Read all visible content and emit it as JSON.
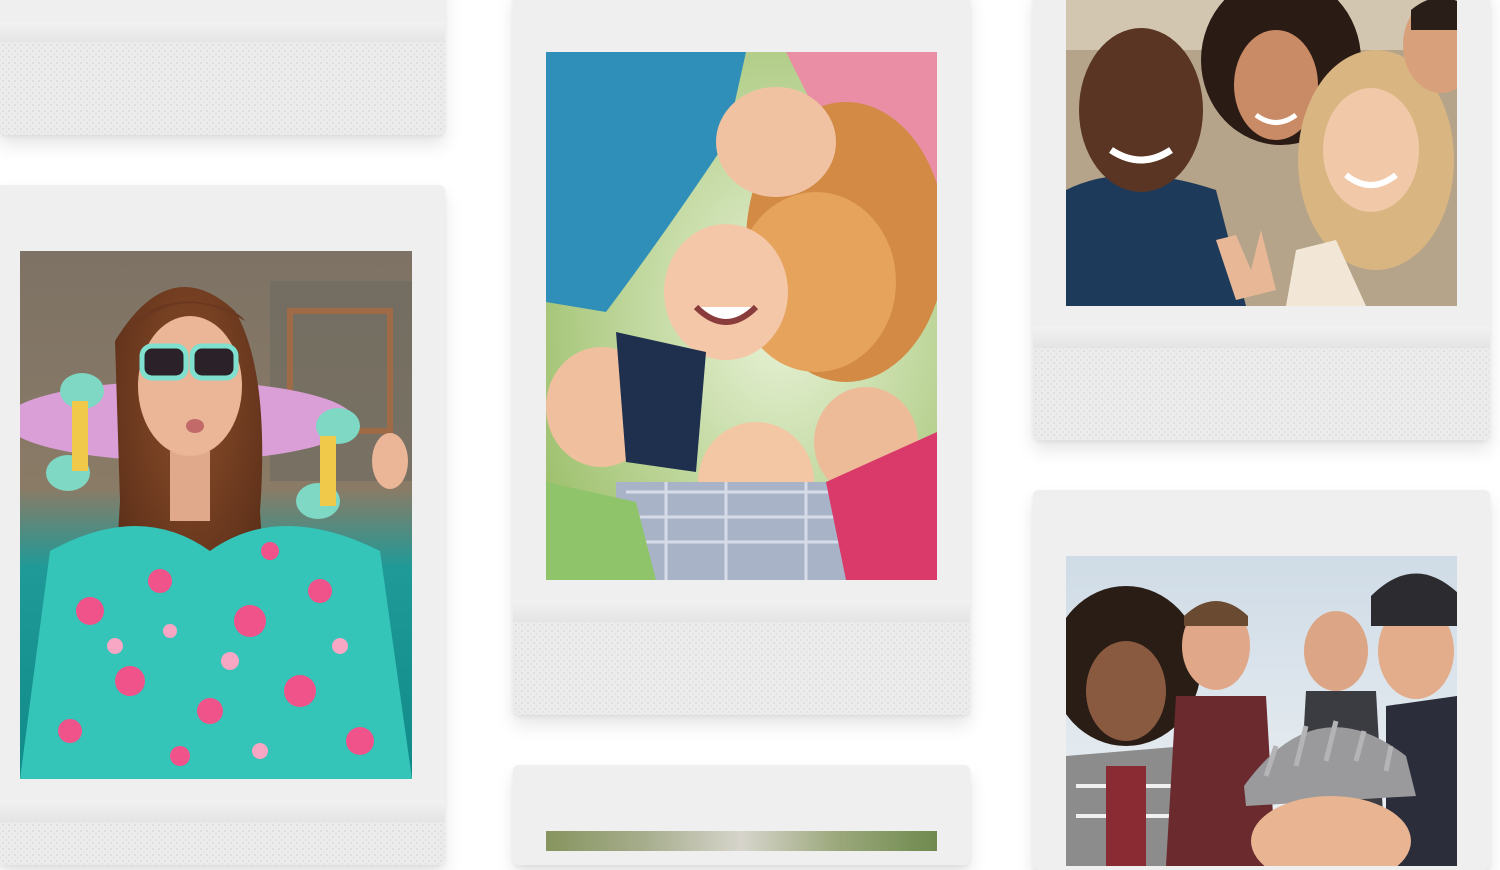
{
  "gallery": {
    "background": "#ffffff",
    "frame_color": "#efefef",
    "photos": [
      {
        "subject": "woman-sunglasses-skateboard-photo"
      },
      {
        "subject": "children-huddle-looking-down-photo"
      },
      {
        "subject": "friends-selfie-group-photo"
      },
      {
        "subject": "friends-winter-hats-group-photo"
      },
      {
        "subject": "partial-photo-top-left"
      },
      {
        "subject": "partial-photo-bottom-center"
      }
    ]
  }
}
